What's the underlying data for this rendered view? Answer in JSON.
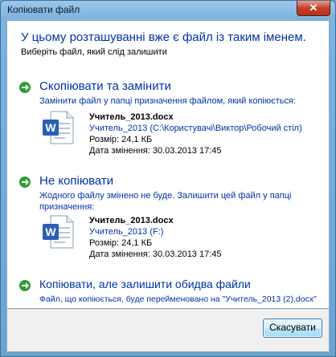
{
  "window": {
    "title": "Копіювати файл",
    "close_icon": "close-icon"
  },
  "header": {
    "heading": "У цьому розташуванні вже є файл із таким іменем.",
    "subheading": "Виберіть файл, який слід залишити"
  },
  "options": [
    {
      "title": "Скопіювати та замінити",
      "description": "Замінити файл у папці призначення файлом, який копіюється:",
      "file": {
        "name": "Учитель_2013.docx",
        "path": "Учитель_2013 (C:\\Користувачі\\Виктор\\Робочий стіл)",
        "size": "Розмір: 24,1 КБ",
        "modified": "Дата змінення: 30.03.2013 17:45"
      }
    },
    {
      "title": "Не копіювати",
      "description": "Жодного файлу змінено не буде. Залишити цей файл у папці призначення:",
      "file": {
        "name": "Учитель_2013.docx",
        "path": "Учитель_2013 (F:)",
        "size": "Розмір: 24,1 КБ",
        "modified": "Дата змінення: 30.03.2013 17:45"
      }
    },
    {
      "title": "Копіювати, але залишити обидва файли",
      "description": "Файл, що копіюється, буде перейменовано на \"Учитель_2013 (2).docx\""
    }
  ],
  "footer": {
    "cancel_label": "Скасувати"
  },
  "colors": {
    "accent": "#0033aa",
    "arrow": "#2e9e2e"
  }
}
